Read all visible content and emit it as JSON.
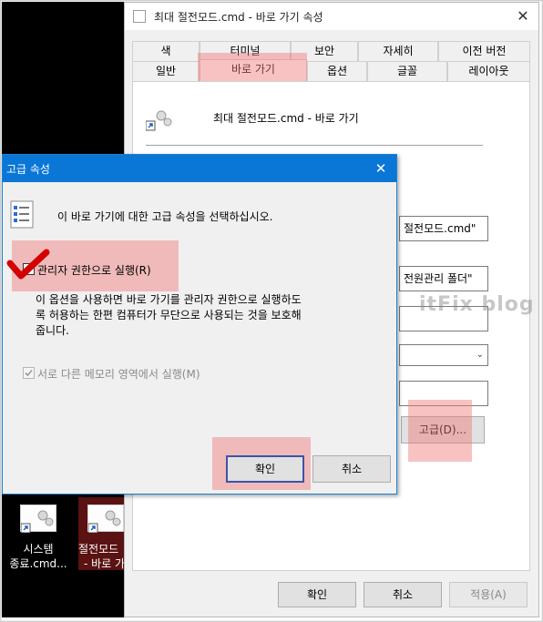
{
  "main_window": {
    "title": "최대 절전모드.cmd - 바로 가기 속성",
    "close_glyph": "✕",
    "tabs_row1": [
      "색",
      "터미널",
      "보안",
      "자세히",
      "이전 버전"
    ],
    "tabs_row2": [
      "일반",
      "바로 가기",
      "옵션",
      "글꼴",
      "레이아웃"
    ],
    "active_tab": "바로 가기",
    "shortcut_name": "최대 절전모드.cmd - 바로 가기",
    "target_value": "절전모드.cmd\"",
    "start_in_value": "전원관리 폴더\"",
    "advanced_button": "고급(D)...",
    "ok_button": "확인",
    "cancel_button": "취소",
    "apply_button": "적용(A)"
  },
  "advanced_dialog": {
    "title": "고급 속성",
    "close_glyph": "✕",
    "prompt": "이 바로 가기에 대한 고급 속성을 선택하십시오.",
    "run_as_admin_label": "관리자 권한으로 실행(R)",
    "run_as_admin_checked": true,
    "description": [
      "이 옵션을 사용하면 바로 가기를 관리자 권한으로 실행하도",
      "록 허용하는 한편 컴퓨터가 무단으로 사용되는 것을 보호해",
      "줍니다."
    ],
    "separate_memory_label": "서로 다른 메모리 영역에서 실행(M)",
    "ok_button": "확인",
    "cancel_button": "취소"
  },
  "desktop": {
    "icons": [
      {
        "label_line1": "시스템",
        "label_line2": "종료.cmd..."
      },
      {
        "label_line1": "절전모드",
        "label_line2": "- 바로 가"
      }
    ]
  },
  "watermark": "itFix blog",
  "colors": {
    "highlight": "#f07878",
    "accent_blue": "#0a76d6",
    "check_red": "#d40000"
  }
}
